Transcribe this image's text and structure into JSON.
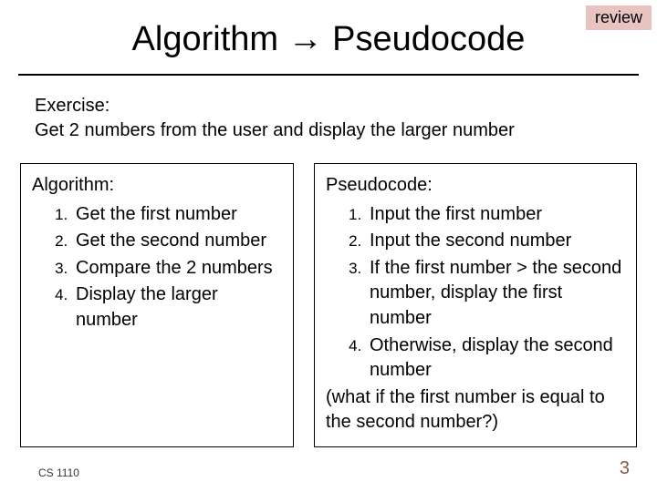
{
  "badge": "review",
  "title": "Algorithm → Pseudocode",
  "exercise": {
    "label": "Exercise:",
    "text": "Get 2 numbers from the user and display the larger number"
  },
  "algorithm": {
    "heading": "Algorithm:",
    "items": [
      "Get the first number",
      "Get the second number",
      "Compare the 2 numbers",
      "Display the larger number"
    ]
  },
  "pseudocode": {
    "heading": "Pseudocode:",
    "items": [
      "Input the first number",
      "Input the second number",
      "If the first number > the second number, display the first number",
      "Otherwise, display the second number"
    ],
    "note": "(what if the first number is equal to the second number?)"
  },
  "footer": {
    "course": "CS 1110",
    "page": "3"
  }
}
